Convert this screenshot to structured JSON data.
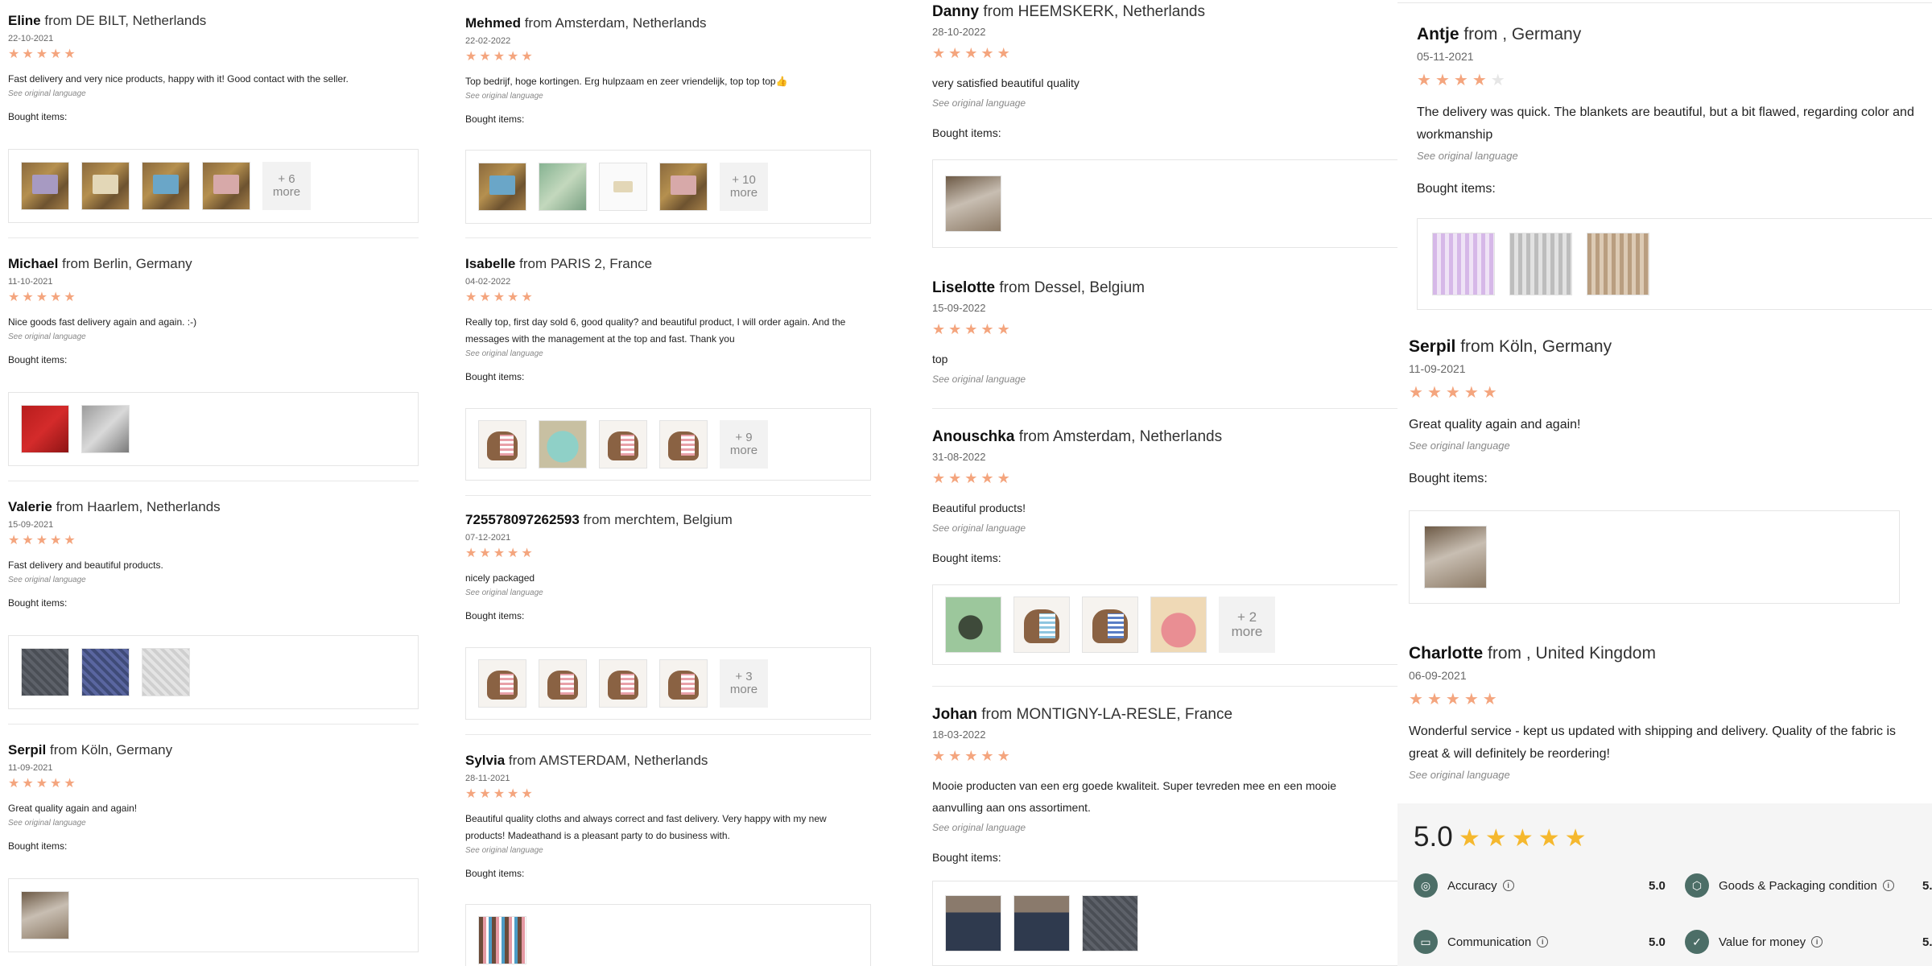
{
  "common": {
    "from": "from",
    "see_original": "See original language",
    "bought_items": "Bought items:"
  },
  "col1": [
    {
      "name": "Eline",
      "location": "DE BILT, Netherlands",
      "date": "22-10-2021",
      "text": "Fast delivery and very nice products, happy with it! Good contact with the seller.",
      "more": [
        "+ 6",
        "more"
      ]
    },
    {
      "name": "Michael",
      "location": "Berlin, Germany",
      "date": "11-10-2021",
      "text": "Nice goods fast delivery again and again. :-)"
    },
    {
      "name": "Valerie",
      "location": "Haarlem, Netherlands",
      "date": "15-09-2021",
      "text": "Fast delivery and beautiful products."
    },
    {
      "name": "Serpil",
      "location": "Köln, Germany",
      "date": "11-09-2021",
      "text": "Great quality again and again!"
    }
  ],
  "col2": [
    {
      "name": "Mehmed",
      "location": "Amsterdam, Netherlands",
      "date": "22-02-2022",
      "text": "Top bedrijf, hoge kortingen. Erg hulpzaam en zeer vriendelijk, top top top👍",
      "more": [
        "+ 10",
        "more"
      ]
    },
    {
      "name": "Isabelle",
      "location": "PARIS 2, France",
      "date": "04-02-2022",
      "text": "Really top, first day sold 6, good quality? and beautiful product, I will order again. And the messages with the management at the top and fast. Thank you",
      "more": [
        "+ 9",
        "more"
      ]
    },
    {
      "name": "725578097262593",
      "location": "merchtem, Belgium",
      "date": "07-12-2021",
      "text": "nicely packaged",
      "more": [
        "+ 3",
        "more"
      ]
    },
    {
      "name": "Sylvia",
      "location": "AMSTERDAM, Netherlands",
      "date": "28-11-2021",
      "text": "Beautiful quality cloths and always correct and fast delivery. Very happy with my new products! Madeathand is a pleasant party to do business with."
    }
  ],
  "col3": [
    {
      "name": "Danny",
      "location": "HEEMSKERK, Netherlands",
      "date": "28-10-2022",
      "text": "very satisfied beautiful quality"
    },
    {
      "name": "Liselotte",
      "location": "Dessel, Belgium",
      "date": "15-09-2022",
      "text": "top"
    },
    {
      "name": "Anouschka",
      "location": "Amsterdam, Netherlands",
      "date": "31-08-2022",
      "text": "Beautiful products!",
      "more": [
        "+ 2",
        "more"
      ]
    },
    {
      "name": "Johan",
      "location": "MONTIGNY-LA-RESLE, France",
      "date": "18-03-2022",
      "text": "Mooie producten van een erg goede kwaliteit. Super tevreden mee en een mooie aanvulling aan ons assortiment."
    }
  ],
  "col4": [
    {
      "name": "Antje",
      "location": ", Germany",
      "date": "05-11-2021",
      "text": "The delivery was quick. The blankets are beautiful, but a bit flawed, regarding color and workmanship",
      "stars": 4
    },
    {
      "name": "Serpil",
      "location": "Köln, Germany",
      "date": "11-09-2021",
      "text": "Great quality again and again!"
    },
    {
      "name": "Charlotte",
      "location": ", United Kingdom",
      "date": "06-09-2021",
      "text": "Wonderful service - kept us updated with shipping and delivery. Quality of the fabric is great & will definitely be reordering!"
    }
  ],
  "summary": {
    "overall": "5.0",
    "star_color": "#f5b82e",
    "metrics": [
      {
        "label": "Accuracy",
        "value": "5.0",
        "icon": "accuracy-badge-icon"
      },
      {
        "label": "Goods & Packaging condition",
        "value": "5.",
        "icon": "package-icon"
      },
      {
        "label": "Communication",
        "value": "5.0",
        "icon": "chat-icon"
      },
      {
        "label": "Value for money",
        "value": "5.",
        "icon": "check-circle-icon"
      }
    ]
  },
  "colors": {
    "review_star": "#f4a57e",
    "accent": "#4c6e67"
  }
}
